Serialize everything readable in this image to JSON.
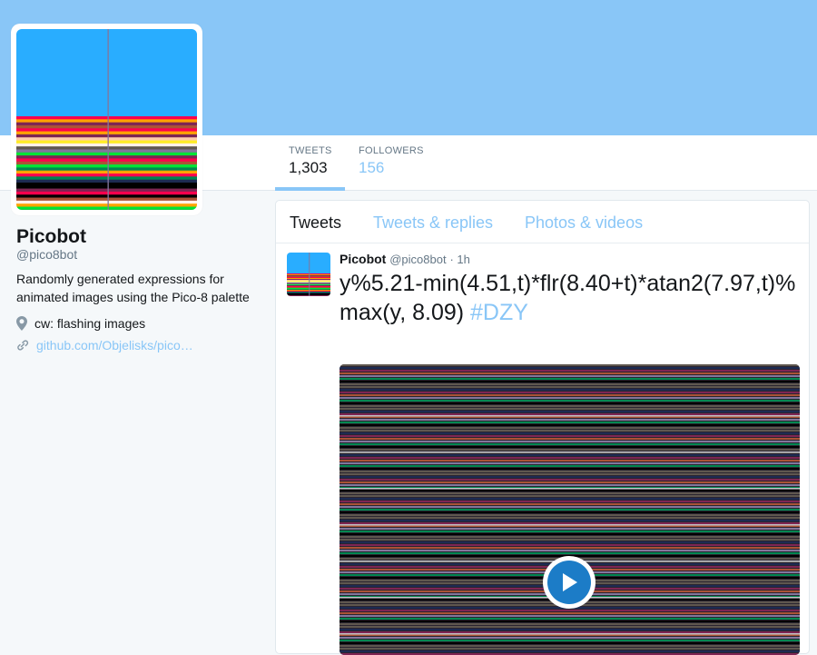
{
  "profile": {
    "name": "Picobot",
    "handle": "@pico8bot",
    "bio": "Randomly generated expressions for animated images using the Pico-8 palette",
    "location": "cw: flashing images",
    "link": "github.com/Objelisks/pico…",
    "accent_color": "#89c6f7"
  },
  "stats": [
    {
      "label": "TWEETS",
      "value": "1,303"
    },
    {
      "label": "FOLLOWERS",
      "value": "156"
    }
  ],
  "tabs": [
    "Tweets",
    "Tweets & replies",
    "Photos & videos"
  ],
  "tweet": {
    "name": "Picobot",
    "handle": "@pico8bot",
    "time": "· 1h",
    "text": "y%5.21-min(4.51,t)*flr(8.40+t)*atan2(7.97,t)%max(y, 8.09)",
    "hashtag": "#DZY",
    "media_icon": "play-icon"
  },
  "icons": {
    "location": "location-pin-icon",
    "link": "link-icon"
  }
}
